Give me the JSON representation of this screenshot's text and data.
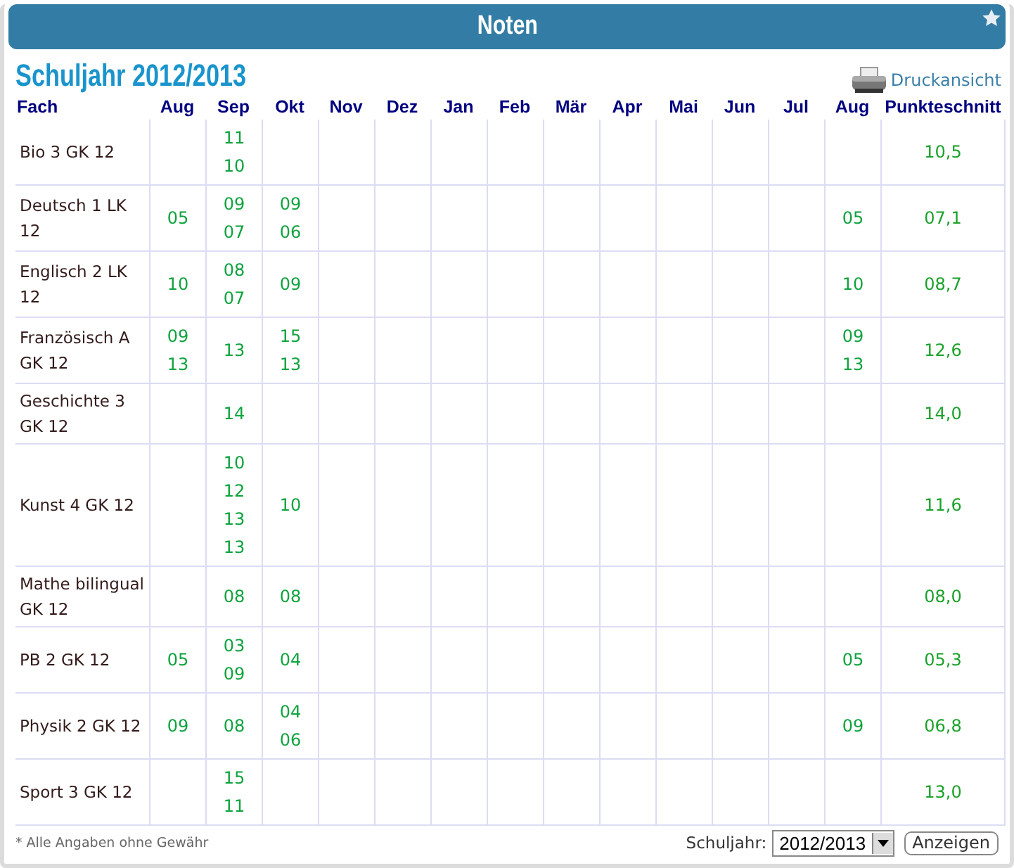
{
  "window": {
    "title": "Noten"
  },
  "subtitle": "Schuljahr 2012/2013",
  "print_link": "Druckansicht",
  "table": {
    "columns": [
      "Fach",
      "Aug",
      "Sep",
      "Okt",
      "Nov",
      "Dez",
      "Jan",
      "Feb",
      "Mär",
      "Apr",
      "Mai",
      "Jun",
      "Jul",
      "Aug",
      "Punkteschnitt"
    ],
    "rows": [
      {
        "subject": "Bio 3 GK 12",
        "sep": [
          "11",
          "10"
        ],
        "average": "10,5"
      },
      {
        "subject": "Deutsch 1 LK 12",
        "aug": [
          "05"
        ],
        "sep": [
          "09",
          "07"
        ],
        "okt": [
          "09",
          "06"
        ],
        "aug_2": [
          "05"
        ],
        "average": "07,1"
      },
      {
        "subject": "Englisch 2 LK 12",
        "aug": [
          "10"
        ],
        "sep": [
          "08",
          "07"
        ],
        "okt": [
          "09"
        ],
        "aug_2": [
          "10"
        ],
        "average": "08,7"
      },
      {
        "subject": "Französisch A GK 12",
        "aug": [
          "09",
          "13"
        ],
        "sep": [
          "13"
        ],
        "okt": [
          "15",
          "13"
        ],
        "aug_2": [
          "09",
          "13"
        ],
        "average": "12,6"
      },
      {
        "subject": "Geschichte 3 GK 12",
        "sep": [
          "14"
        ],
        "average": "14,0"
      },
      {
        "subject": "Kunst 4 GK 12",
        "sep": [
          "10",
          "12",
          "13",
          "13"
        ],
        "okt": [
          "10"
        ],
        "average": "11,6"
      },
      {
        "subject": "Mathe bilingual GK 12",
        "sep": [
          "08"
        ],
        "okt": [
          "08"
        ],
        "average": "08,0"
      },
      {
        "subject": "PB 2 GK 12",
        "aug": [
          "05"
        ],
        "sep": [
          "03",
          "09"
        ],
        "okt": [
          "04"
        ],
        "aug_2": [
          "05"
        ],
        "average": "05,3"
      },
      {
        "subject": "Physik 2 GK 12",
        "aug": [
          "09"
        ],
        "sep": [
          "08"
        ],
        "okt": [
          "04",
          "06"
        ],
        "aug_2": [
          "09"
        ],
        "average": "06,8"
      },
      {
        "subject": "Sport 3 GK 12",
        "sep": [
          "15",
          "11"
        ],
        "average": "13,0"
      }
    ]
  },
  "footer": {
    "note": "* Alle Angaben ohne Gewähr",
    "year_label": "Schuljahr:",
    "year_value": "2012/2013",
    "button": "Anzeigen"
  }
}
